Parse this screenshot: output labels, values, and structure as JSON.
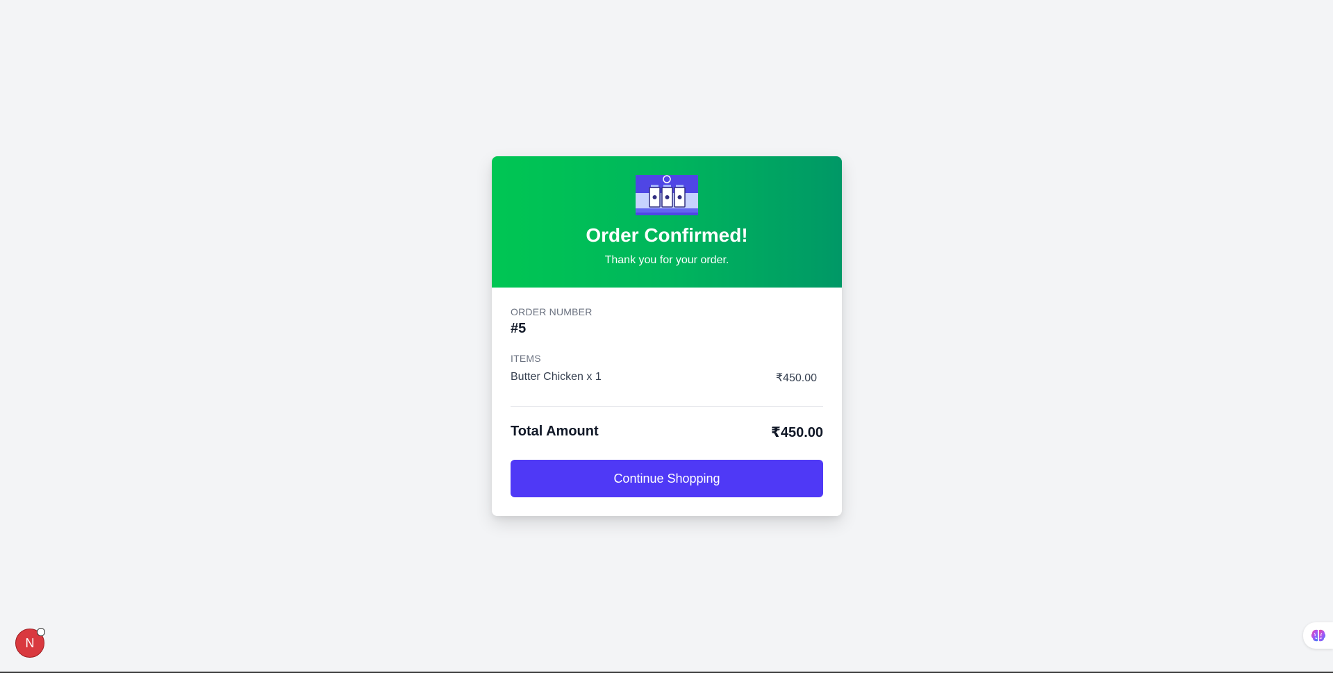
{
  "header": {
    "title": "Order Confirmed!",
    "subtitle": "Thank you for your order.",
    "logo_icon": "store-front-icon"
  },
  "order": {
    "number_label": "ORDER NUMBER",
    "number": "#5",
    "items_label": "ITEMS",
    "items": [
      {
        "name": "Butter Chicken x 1",
        "price": "₹450.00"
      }
    ],
    "total_label": "Total Amount",
    "total": "₹450.00"
  },
  "actions": {
    "continue_label": "Continue Shopping"
  },
  "overlay": {
    "dev_badge_letter": "N",
    "dev_badge_icon": "nextjs-icon",
    "assistant_icon": "brain-icon"
  },
  "colors": {
    "header_start": "#00c653",
    "header_end": "#009866",
    "button": "#4f39f6",
    "background": "#f3f4f6"
  }
}
